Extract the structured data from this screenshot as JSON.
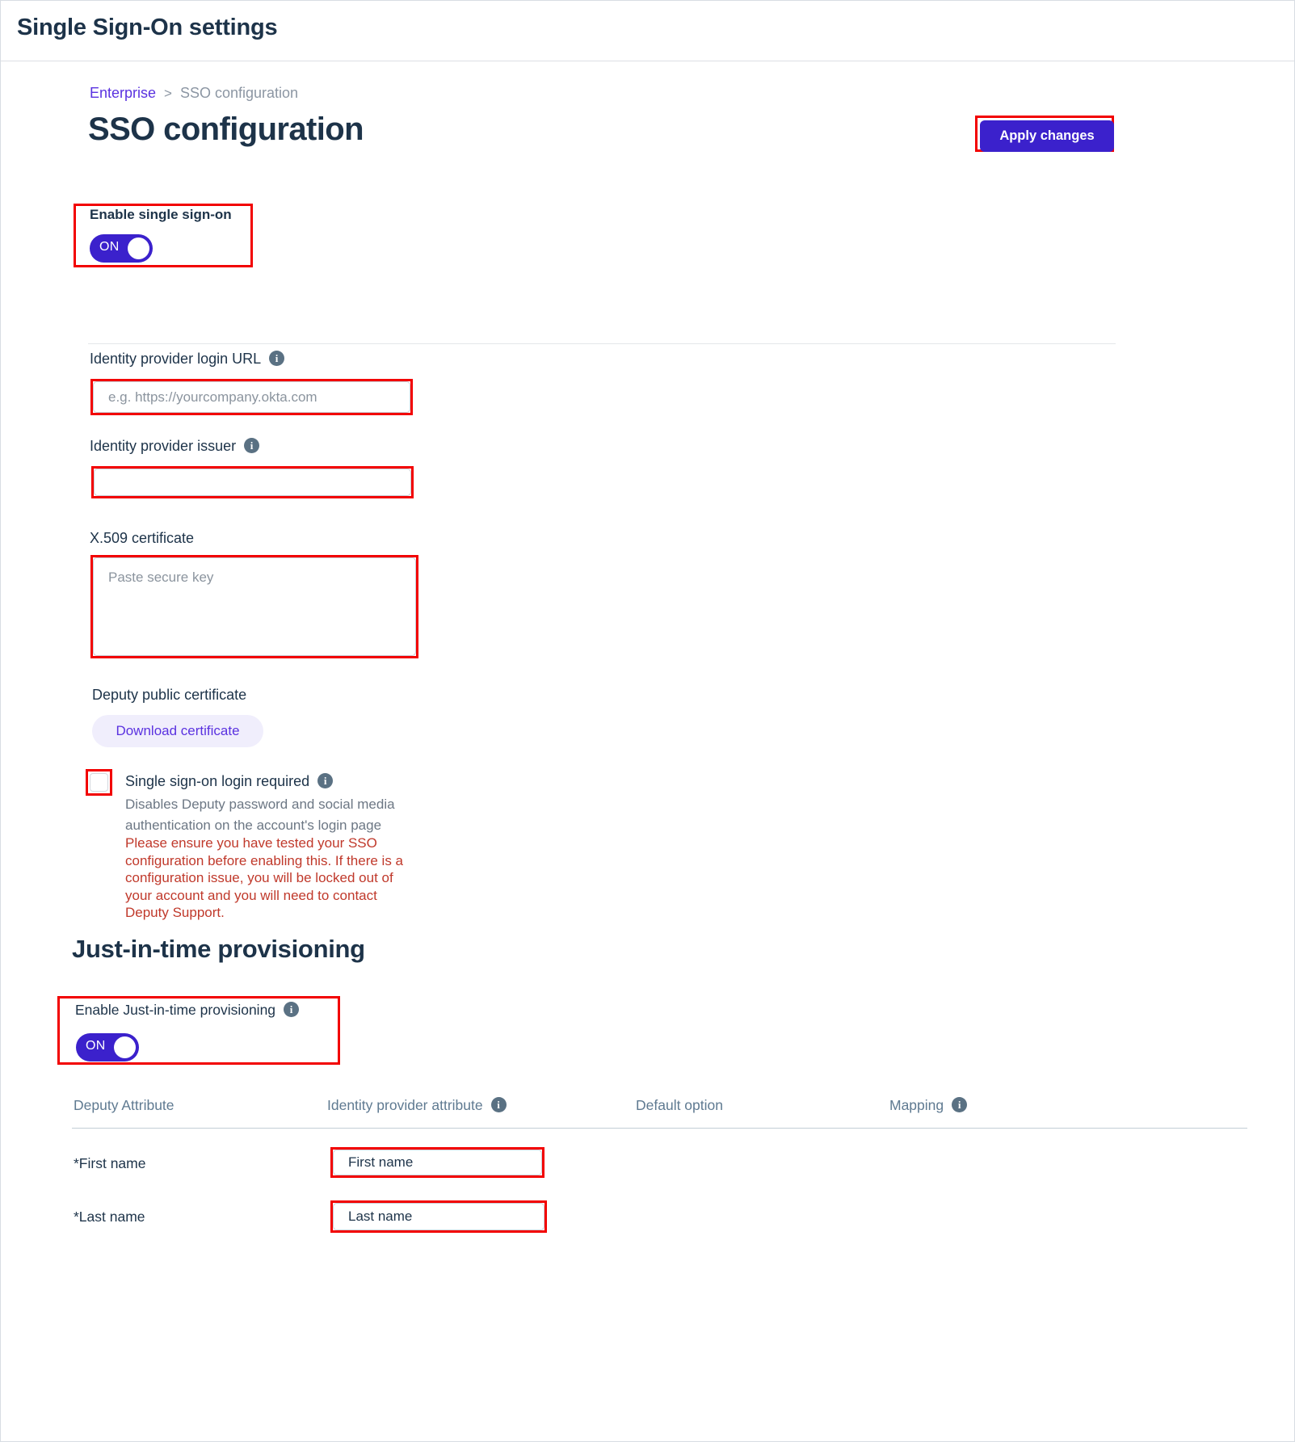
{
  "window": {
    "title": "Single Sign-On settings"
  },
  "breadcrumb": {
    "parent": "Enterprise",
    "separator": ">",
    "current": "SSO configuration"
  },
  "header": {
    "page_title": "SSO configuration",
    "apply_label": "Apply changes"
  },
  "enable_sso": {
    "label": "Enable single sign-on",
    "toggle_state": "ON"
  },
  "fields": {
    "idp_login_url": {
      "label": "Identity provider login URL",
      "info": "i",
      "value": "",
      "placeholder": "e.g. https://yourcompany.okta.com"
    },
    "idp_issuer": {
      "label": "Identity provider issuer",
      "info": "i",
      "value": "",
      "placeholder": ""
    },
    "x509_certificate": {
      "label": "X.509 certificate",
      "value": "",
      "placeholder": "Paste secure key"
    },
    "deputy_public_certificate": {
      "label": "Deputy public certificate",
      "download_label": "Download certificate"
    }
  },
  "sso_login_required": {
    "title": "Single sign-on login required",
    "info": "i",
    "description": "Disables Deputy password and social media authentication on the account's login page",
    "warning": "Please ensure you have tested your SSO configuration before enabling this. If there is a configuration issue, you will be locked out of your account and you will need to contact Deputy Support.",
    "checked": false
  },
  "jit": {
    "heading": "Just-in-time provisioning",
    "enable_label": "Enable Just-in-time provisioning",
    "info": "i",
    "toggle_state": "ON"
  },
  "attribute_table": {
    "columns": [
      {
        "label": "Deputy Attribute",
        "info": ""
      },
      {
        "label": "Identity provider attribute",
        "info": "i"
      },
      {
        "label": "Default option",
        "info": ""
      },
      {
        "label": "Mapping",
        "info": "i"
      }
    ],
    "rows": [
      {
        "deputy_attribute": "*First name",
        "idp_attribute_value": "First name",
        "idp_attribute_placeholder": "First name",
        "default_option": "",
        "mapping": ""
      },
      {
        "deputy_attribute": "*Last name",
        "idp_attribute_value": "Last name",
        "idp_attribute_placeholder": "Last name",
        "default_option": "",
        "mapping": ""
      }
    ]
  },
  "colors": {
    "accent_purple": "#3B21CC",
    "link_purple": "#5A32E0",
    "annotation_red": "#f20000",
    "warning_red": "#c0392b",
    "heading_navy": "#1d3349",
    "muted_slate": "#5f7a91"
  }
}
